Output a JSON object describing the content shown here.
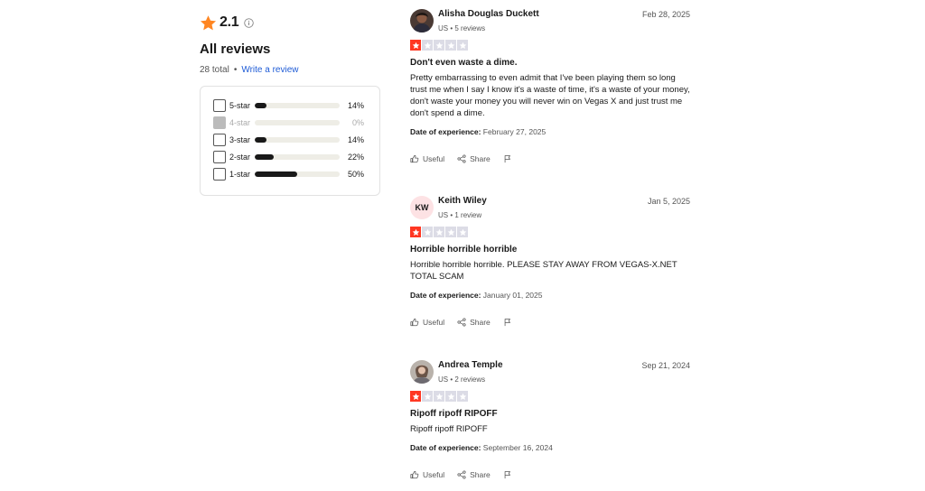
{
  "summary": {
    "rating": "2.1",
    "heading": "All reviews",
    "total": "28 total",
    "separator": "•",
    "write_review": "Write a review",
    "colors": {
      "star": "#ff8622",
      "link": "#1e5bd6",
      "bar": "#191919",
      "track": "#eeede6"
    }
  },
  "filters": [
    {
      "label": "5-star",
      "percent": "14%",
      "fraction": 0.14,
      "disabled": false
    },
    {
      "label": "4-star",
      "percent": "0%",
      "fraction": 0.0,
      "disabled": true
    },
    {
      "label": "3-star",
      "percent": "14%",
      "fraction": 0.14,
      "disabled": false
    },
    {
      "label": "2-star",
      "percent": "22%",
      "fraction": 0.22,
      "disabled": false
    },
    {
      "label": "1-star",
      "percent": "50%",
      "fraction": 0.5,
      "disabled": false
    }
  ],
  "reviews": [
    {
      "name": "Alisha Douglas Duckett",
      "meta": "US • 5 reviews",
      "date": "Feb 28, 2025",
      "stars": 1,
      "title": "Don't even waste a dime.",
      "body": "Pretty embarrassing to even admit that I've been playing them so long trust me when I say I know it's a waste of time, it's a waste of your money, don't waste your money you will never win on Vegas X and just trust me don't spend a dime.",
      "exp_label": "Date of experience:",
      "exp_date": "February 27, 2025",
      "avatar": "photo"
    },
    {
      "name": "Keith Wiley",
      "meta": "US • 1 review",
      "date": "Jan 5, 2025",
      "stars": 1,
      "title": "Horrible horrible horrible",
      "body": "Horrible horrible horrible. PLEASE STAY AWAY FROM VEGAS-X.NET TOTAL SCAM",
      "exp_label": "Date of experience:",
      "exp_date": "January 01, 2025",
      "avatar": "initials",
      "initials": "KW"
    },
    {
      "name": "Andrea Temple",
      "meta": "US • 2 reviews",
      "date": "Sep 21, 2024",
      "stars": 1,
      "title": "Ripoff ripoff RIPOFF",
      "body": "Ripoff ripoff RIPOFF",
      "exp_label": "Date of experience:",
      "exp_date": "September 16, 2024",
      "avatar": "photo"
    }
  ],
  "actions": {
    "useful": "Useful",
    "share": "Share"
  },
  "star_colors": {
    "on": "#ff3722",
    "off": "#dcdce6"
  }
}
